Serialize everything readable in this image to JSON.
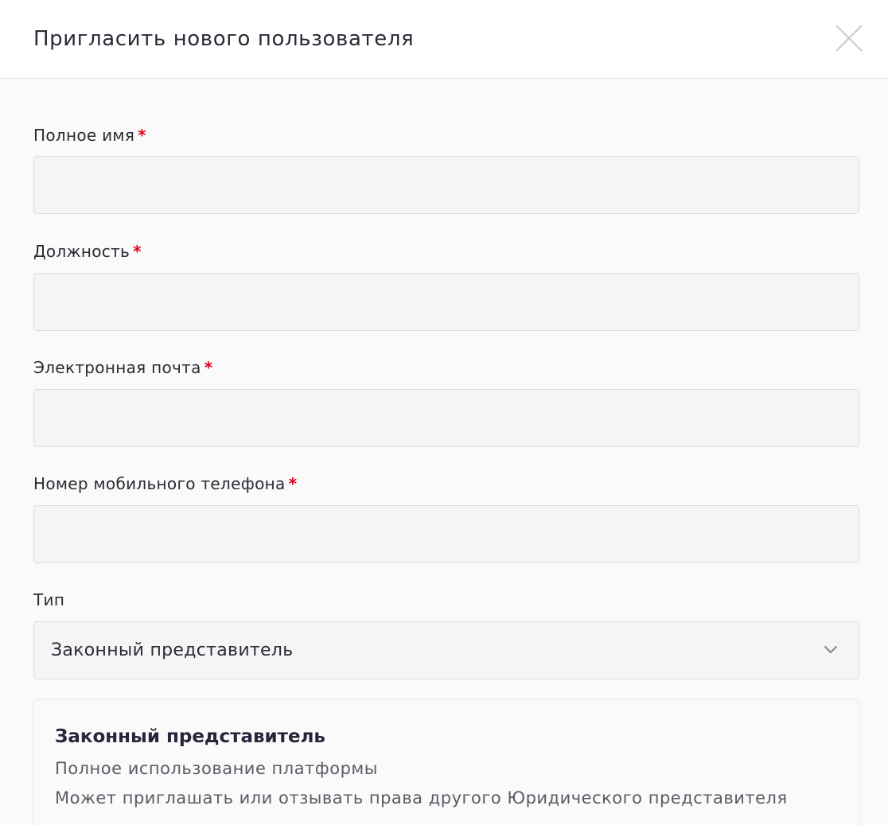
{
  "dialog": {
    "title": "Пригласить нового пользователя",
    "close_icon": "close-icon"
  },
  "form": {
    "required_mark": "*",
    "full_name": {
      "label": "Полное имя",
      "value": "",
      "required": true
    },
    "position": {
      "label": "Должность",
      "value": "",
      "required": true
    },
    "email": {
      "label": "Электронная почта",
      "value": "",
      "required": true
    },
    "phone": {
      "label": "Номер мобильного телефона",
      "value": "",
      "required": true
    },
    "type": {
      "label": "Тип",
      "selected": "Законный представитель",
      "icon": "chevron-down-icon"
    }
  },
  "role_info": {
    "title": "Законный представитель",
    "lines": [
      "Полное использование платформы",
      "Может приглашать или отзывать права другого Юридического представителя"
    ]
  },
  "colors": {
    "required": "#e0001a",
    "text": "#2b2b38",
    "muted_text": "#5b5b66",
    "input_bg": "#f5f5f6",
    "border": "#dcdce0"
  }
}
